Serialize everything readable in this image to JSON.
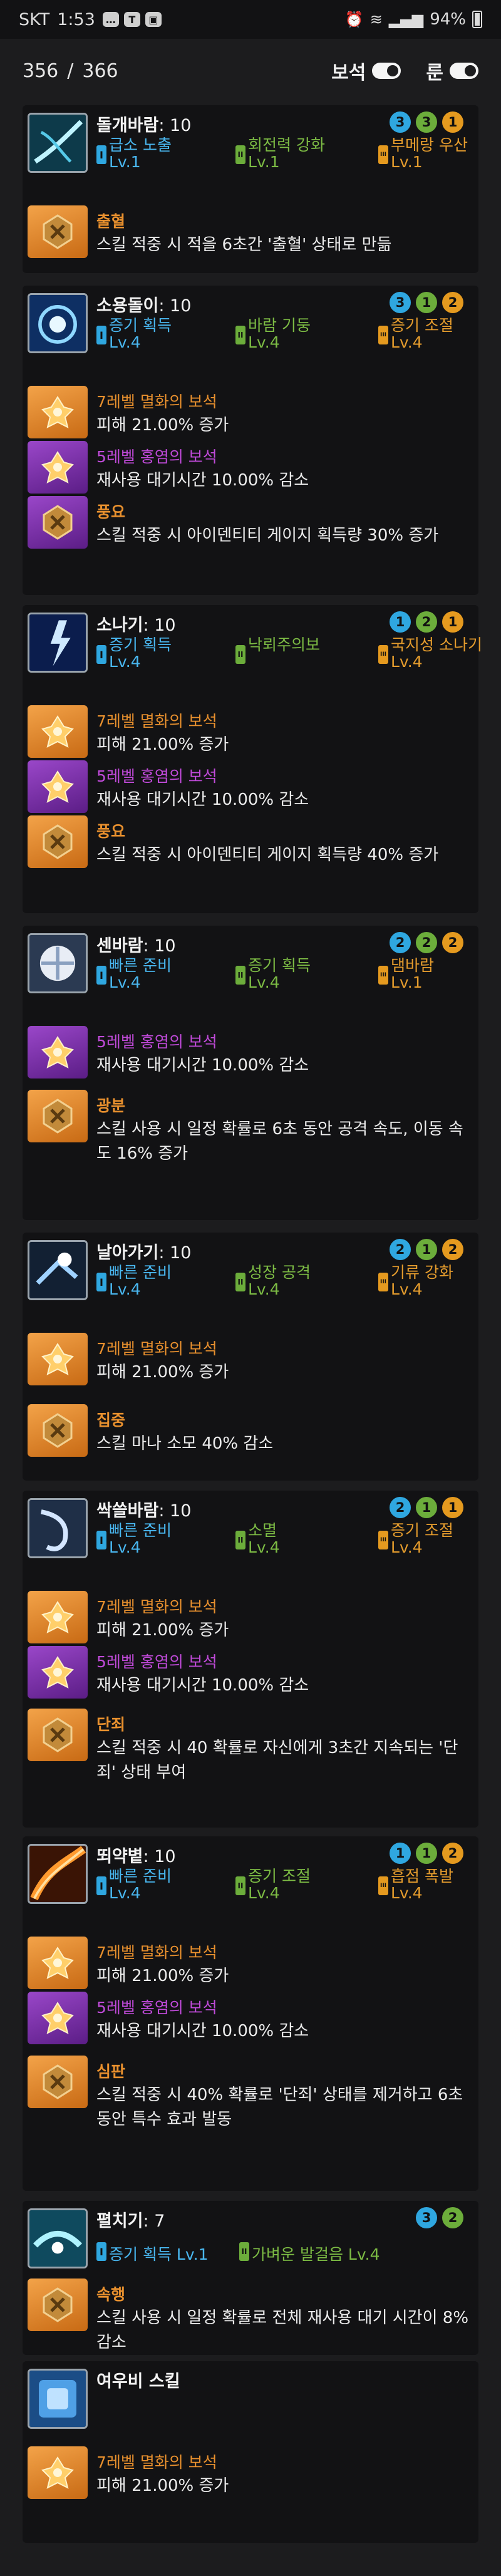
{
  "status_bar": {
    "carrier": "SKT",
    "time": "1:53",
    "notif_icons": [
      "message-icon",
      "talk-icon",
      "image-icon"
    ],
    "battery": "94%"
  },
  "header": {
    "current": "356",
    "separator": "/",
    "total": "366",
    "toggle_gem": "보석",
    "toggle_rune": "룬"
  },
  "colors": {
    "tripod1": "#2fa7e0",
    "tripod2": "#6cad3b",
    "tripod3": "#e59a1f",
    "gem_orange": "#e8902e",
    "gem_purple": "#c04ad9"
  },
  "skills": [
    {
      "name": "돌개바람",
      "level": ": 10",
      "badges": [
        "3",
        "3",
        "1"
      ],
      "tripods": [
        {
          "tier": "I",
          "name": "급소 노출",
          "level": "Lv.1"
        },
        {
          "tier": "II",
          "name": "회전력 강화",
          "level": "Lv.1"
        },
        {
          "tier": "III",
          "name": "부메랑 우산",
          "level": "Lv.1"
        }
      ],
      "rows": [
        {
          "type": "rune",
          "title": "출혈",
          "desc": "스킬 적중 시 적을 6초간 '출혈' 상태로 만듦"
        }
      ]
    },
    {
      "name": "소용돌이",
      "level": ": 10",
      "badges": [
        "3",
        "1",
        "2"
      ],
      "tripods": [
        {
          "tier": "I",
          "name": "증기 획득",
          "level": "Lv.4"
        },
        {
          "tier": "II",
          "name": "바람 기둥",
          "level": "Lv.4"
        },
        {
          "tier": "III",
          "name": "증기 조절",
          "level": "Lv.4"
        }
      ],
      "rows": [
        {
          "type": "gem-orange",
          "title": "7레벨 멸화의 보석",
          "desc": "피해 21.00% 증가"
        },
        {
          "type": "gem-purple",
          "title": "5레벨 홍염의 보석",
          "desc": "재사용 대기시간 10.00% 감소"
        },
        {
          "type": "rune-purple",
          "title": "풍요",
          "desc": "스킬 적중 시 아이덴티티 게이지 획득량 30% 증가"
        }
      ]
    },
    {
      "name": "소나기",
      "level": ": 10",
      "badges": [
        "1",
        "2",
        "1"
      ],
      "tripods": [
        {
          "tier": "I",
          "name": "증기 획득",
          "level": "Lv.4"
        },
        {
          "tier": "II",
          "name": "낙뢰주의보",
          "level": ""
        },
        {
          "tier": "III",
          "name": "국지성 소나기",
          "level": "Lv.4"
        }
      ],
      "rows": [
        {
          "type": "gem-orange",
          "title": "7레벨 멸화의 보석",
          "desc": "피해 21.00% 증가"
        },
        {
          "type": "gem-purple",
          "title": "5레벨 홍염의 보석",
          "desc": "재사용 대기시간 10.00% 감소"
        },
        {
          "type": "rune",
          "title": "풍요",
          "desc": "스킬 적중 시 아이덴티티 게이지 획득량 40% 증가"
        }
      ]
    },
    {
      "name": "센바람",
      "level": ": 10",
      "badges": [
        "2",
        "2",
        "2"
      ],
      "tripods": [
        {
          "tier": "I",
          "name": "빠른 준비",
          "level": "Lv.4"
        },
        {
          "tier": "II",
          "name": "증기 획득",
          "level": "Lv.4"
        },
        {
          "tier": "III",
          "name": "댐바람",
          "level": "Lv.1"
        }
      ],
      "rows": [
        {
          "type": "gem-purple",
          "title": "5레벨 홍염의 보석",
          "desc": "재사용 대기시간 10.00% 감소"
        },
        {
          "type": "rune",
          "title": "광분",
          "desc": "스킬 사용 시 일정 확률로 6초 동안 공격 속도, 이동 속도 16% 증가"
        }
      ]
    },
    {
      "name": "날아가기",
      "level": ": 10",
      "badges": [
        "2",
        "1",
        "2"
      ],
      "tripods": [
        {
          "tier": "I",
          "name": "빠른 준비",
          "level": "Lv.4"
        },
        {
          "tier": "II",
          "name": "성장 공격",
          "level": "Lv.4"
        },
        {
          "tier": "III",
          "name": "기류 강화",
          "level": "Lv.4"
        }
      ],
      "rows": [
        {
          "type": "gem-orange",
          "title": "7레벨 멸화의 보석",
          "desc": "피해 21.00% 증가"
        },
        {
          "type": "rune",
          "title": "집중",
          "desc": "스킬 마나 소모 40% 감소"
        }
      ]
    },
    {
      "name": "싹쓸바람",
      "level": ": 10",
      "badges": [
        "2",
        "1",
        "1"
      ],
      "tripods": [
        {
          "tier": "I",
          "name": "빠른 준비",
          "level": "Lv.4"
        },
        {
          "tier": "II",
          "name": "소멸",
          "level": "Lv.4"
        },
        {
          "tier": "III",
          "name": "증기 조절",
          "level": "Lv.4"
        }
      ],
      "rows": [
        {
          "type": "gem-orange",
          "title": "7레벨 멸화의 보석",
          "desc": "피해 21.00% 증가"
        },
        {
          "type": "gem-purple",
          "title": "5레벨 홍염의 보석",
          "desc": "재사용 대기시간 10.00% 감소"
        },
        {
          "type": "rune",
          "title": "단죄",
          "desc": "스킬 적중 시 40 확률로 자신에게 3초간 지속되는 '단죄' 상태 부여"
        }
      ]
    },
    {
      "name": "뙤약볕",
      "level": ": 10",
      "badges": [
        "1",
        "1",
        "2"
      ],
      "tripods": [
        {
          "tier": "I",
          "name": "빠른 준비",
          "level": "Lv.4"
        },
        {
          "tier": "II",
          "name": "증기 조절",
          "level": "Lv.4"
        },
        {
          "tier": "III",
          "name": "흡점 폭발",
          "level": "Lv.4"
        }
      ],
      "rows": [
        {
          "type": "gem-orange",
          "title": "7레벨 멸화의 보석",
          "desc": "피해 21.00% 증가"
        },
        {
          "type": "gem-purple",
          "title": "5레벨 홍염의 보석",
          "desc": "재사용 대기시간 10.00% 감소"
        },
        {
          "type": "rune",
          "title": "심판",
          "desc": "스킬 적중 시 40% 확률로 '단죄' 상태를 제거하고 6초 동안 특수 효과 발동"
        }
      ]
    },
    {
      "name": "펼치기",
      "level": ": 7",
      "badges": [
        "3",
        "2"
      ],
      "tripods": [
        {
          "tier": "I",
          "name": "증기 획득 Lv.1",
          "level": ""
        },
        {
          "tier": "II",
          "name": "가벼운 발걸음 Lv.4",
          "level": ""
        }
      ],
      "rows": [
        {
          "type": "rune",
          "title": "속행",
          "desc": "스킬 사용 시 일정 확률로 전체 재사용 대기 시간이 8% 감소"
        }
      ]
    },
    {
      "name": "여우비 스킬",
      "level": "",
      "badges": [],
      "tripods": [],
      "rows": [
        {
          "type": "gem-orange",
          "title": "7레벨 멸화의 보석",
          "desc": "피해 21.00% 증가"
        }
      ]
    }
  ]
}
